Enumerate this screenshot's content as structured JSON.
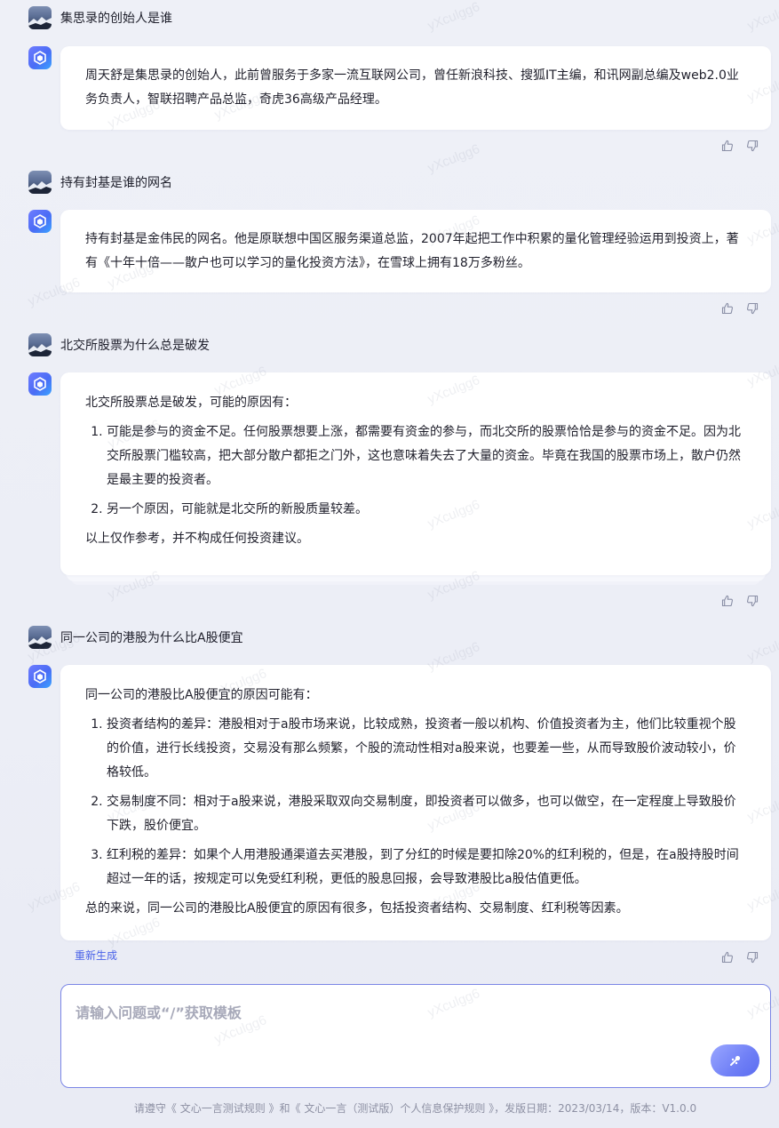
{
  "conversation": [
    {
      "question": "集思录的创始人是谁",
      "answer": {
        "intro": "周天舒是集思录的创始人，此前曾服务于多家一流互联网公司，曾任新浪科技、搜狐IT主编，和讯网副总编及web2.0业务负责人，智联招聘产品总监，奇虎36高级产品经理。",
        "items": [],
        "conclusion": ""
      }
    },
    {
      "question": "持有封基是谁的网名",
      "answer": {
        "intro": "持有封基是金伟民的网名。他是原联想中国区服务渠道总监，2007年起把工作中积累的量化管理经验运用到投资上，著有《十年十倍——散户也可以学习的量化投资方法》，在雪球上拥有18万多粉丝。",
        "items": [],
        "conclusion": ""
      }
    },
    {
      "question": "北交所股票为什么总是破发",
      "answer": {
        "intro": "北交所股票总是破发，可能的原因有：",
        "items": [
          "可能是参与的资金不足。任何股票想要上涨，都需要有资金的参与，而北交所的股票恰恰是参与的资金不足。因为北交所股票门槛较高，把大部分散户都拒之门外，这也意味着失去了大量的资金。毕竟在我国的股票市场上，散户仍然是最主要的投资者。",
          "另一个原因，可能就是北交所的新股质量较差。"
        ],
        "conclusion": "以上仅作参考，并不构成任何投资建议。"
      }
    },
    {
      "question": "同一公司的港股为什么比A股便宜",
      "answer": {
        "intro": "同一公司的港股比A股便宜的原因可能有：",
        "items": [
          "投资者结构的差异：港股相对于a股市场来说，比较成熟，投资者一般以机构、价值投资者为主，他们比较重视个股的价值，进行长线投资，交易没有那么频繁，个股的流动性相对a股来说，也要差一些，从而导致股价波动较小，价格较低。",
          "交易制度不同：相对于a股来说，港股采取双向交易制度，即投资者可以做多，也可以做空，在一定程度上导致股价下跌，股价便宜。",
          "红利税的差异：如果个人用港股通渠道去买港股，到了分红的时候是要扣除20%的红利税的，但是，在a股持股时间超过一年的话，按规定可以免受红利税，更低的股息回报，会导致港股比a股估值更低。"
        ],
        "conclusion": "总的来说，同一公司的港股比A股便宜的原因有很多，包括投资者结构、交易制度、红利税等因素。"
      }
    }
  ],
  "regenerate_label": "重新生成",
  "input": {
    "placeholder": "请输入问题或“/”获取模板"
  },
  "footer": "请遵守《 文心一言测试规则 》和《 文心一言（测试版）个人信息保护规则 》，发版日期：2023/03/14，版本：V1.0.0",
  "watermark": "yXculgg6",
  "icons": {
    "question_avatar": "mountain-avatar-icon",
    "bot_avatar": "ernie-bot-logo-icon",
    "like": "thumbs-up-icon",
    "dislike": "thumbs-down-icon",
    "send": "send-icon"
  },
  "colors": {
    "accent": "#4a62e8",
    "input_border": "#7b86e6",
    "send_button": "#6f7ff6"
  }
}
